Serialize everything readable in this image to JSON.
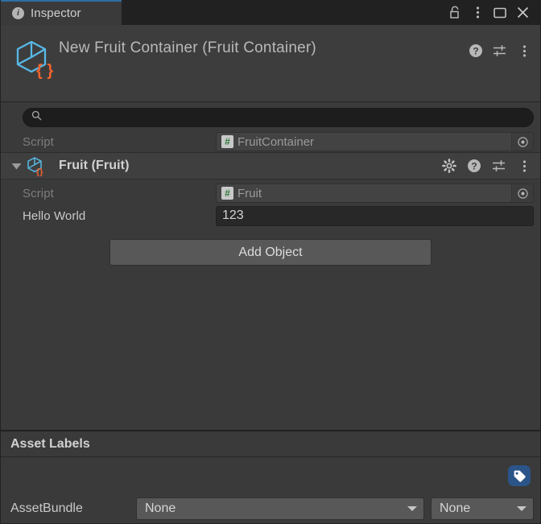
{
  "window": {
    "tab": {
      "label": "Inspector",
      "icon": "info-icon"
    },
    "controls": [
      {
        "name": "lock-icon",
        "label": "Lock"
      },
      {
        "name": "kebab-menu-icon",
        "label": "More"
      },
      {
        "name": "maximize-icon",
        "label": "Maximize"
      },
      {
        "name": "close-icon",
        "label": "Close"
      }
    ],
    "accent_color": "#2f6ea5"
  },
  "object_header": {
    "title": "New Fruit Container (Fruit Container)",
    "icon": "scriptable-object-icon",
    "icons": [
      {
        "name": "help-icon",
        "label": "Help"
      },
      {
        "name": "preset-icon",
        "label": "Preset"
      },
      {
        "name": "kebab-menu-icon",
        "label": "More"
      }
    ]
  },
  "search": {
    "value": "",
    "placeholder": "",
    "icon": "search-icon"
  },
  "root_script": {
    "label": "Script",
    "value": "FruitContainer",
    "icon": "csharp-script-icon",
    "picker": "object-picker-icon"
  },
  "component": {
    "title": "Fruit (Fruit)",
    "foldout": "expanded",
    "icon": "scriptable-object-icon",
    "icons": [
      {
        "name": "gear-icon",
        "label": "Settings"
      },
      {
        "name": "help-icon",
        "label": "Help"
      },
      {
        "name": "preset-icon",
        "label": "Preset"
      },
      {
        "name": "kebab-menu-icon",
        "label": "More"
      }
    ],
    "script": {
      "label": "Script",
      "value": "Fruit",
      "icon": "csharp-script-icon",
      "picker": "object-picker-icon"
    },
    "hello_world": {
      "label": "Hello World",
      "value": "123"
    }
  },
  "add_object_button": {
    "label": "Add Object"
  },
  "asset_labels": {
    "title": "Asset Labels",
    "tag_button": {
      "icon": "tag-icon",
      "color": "#2b5489"
    },
    "bundle": {
      "label": "AssetBundle",
      "name_value": "None",
      "variant_value": "None"
    }
  }
}
